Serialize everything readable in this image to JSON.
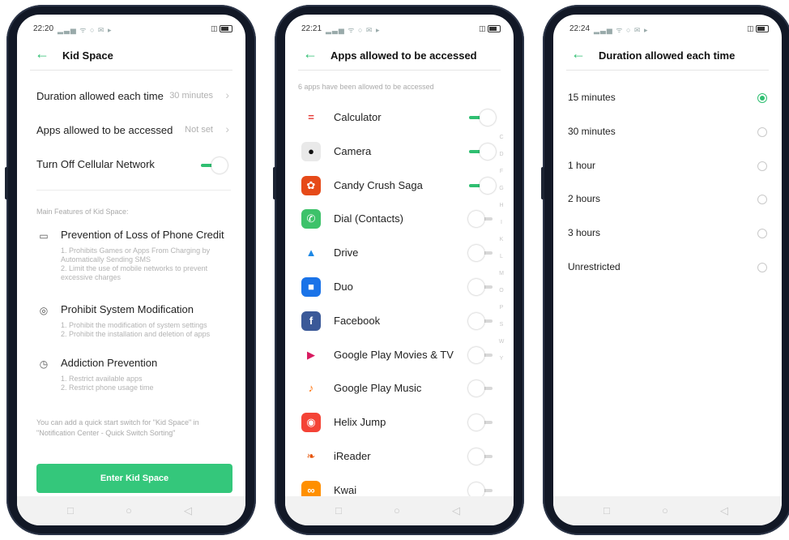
{
  "colors": {
    "accent": "#2fbf71",
    "button": "#34c77b"
  },
  "phones": [
    {
      "status": {
        "time": "22:20"
      },
      "header": {
        "title": "Kid Space"
      },
      "settings": [
        {
          "label": "Duration allowed each time",
          "value": "30 minutes"
        },
        {
          "label": "Apps allowed to be accessed",
          "value": "Not set"
        },
        {
          "label": "Turn Off Cellular Network",
          "toggle": true
        }
      ],
      "features_heading": "Main Features of Kid Space:",
      "features": [
        {
          "title": "Prevention of Loss of Phone Credit",
          "desc": "1. Prohibits Games or Apps From Charging by Automatically Sending SMS\n2. Limit the use of mobile networks to prevent excessive charges"
        },
        {
          "title": "Prohibit System Modification",
          "desc": "1. Prohibit the modification of system settings\n2. Prohibit the installation and deletion of apps"
        },
        {
          "title": "Addiction Prevention",
          "desc": "1. Restrict available apps\n2. Restrict phone usage time"
        }
      ],
      "note": "You can add a quick start switch for \"Kid Space\" in \"Notification Center - Quick Switch Sorting\"",
      "enter_button": "Enter Kid Space"
    },
    {
      "status": {
        "time": "22:21"
      },
      "header": {
        "title": "Apps allowed to be accessed"
      },
      "subtitle": "6 apps have been allowed to be accessed",
      "apps": [
        {
          "name": "Calculator",
          "on": true,
          "icon": "calculator-icon",
          "color": "#ffffff",
          "fg": "#e53935",
          "glyph": "="
        },
        {
          "name": "Camera",
          "on": true,
          "icon": "camera-icon",
          "color": "#e9e9e9",
          "fg": "#111111",
          "glyph": "●"
        },
        {
          "name": "Candy Crush Saga",
          "on": true,
          "icon": "candy-crush-icon",
          "color": "#e64a19",
          "fg": "#ffffff",
          "glyph": "✿"
        },
        {
          "name": "Dial (Contacts)",
          "on": false,
          "icon": "phone-icon",
          "color": "#3dc26a",
          "fg": "#ffffff",
          "glyph": "✆"
        },
        {
          "name": "Drive",
          "on": false,
          "icon": "drive-icon",
          "color": "#ffffff",
          "fg": "#1e88e5",
          "glyph": "▲"
        },
        {
          "name": "Duo",
          "on": false,
          "icon": "duo-icon",
          "color": "#1a73e8",
          "fg": "#ffffff",
          "glyph": "■"
        },
        {
          "name": "Facebook",
          "on": false,
          "icon": "facebook-icon",
          "color": "#3b5998",
          "fg": "#ffffff",
          "glyph": "f"
        },
        {
          "name": "Google Play Movies & TV",
          "on": false,
          "icon": "play-movies-icon",
          "color": "#ffffff",
          "fg": "#d81b60",
          "glyph": "▶"
        },
        {
          "name": "Google Play Music",
          "on": false,
          "icon": "play-music-icon",
          "color": "#ffffff",
          "fg": "#ff6d00",
          "glyph": "♪"
        },
        {
          "name": "Helix Jump",
          "on": false,
          "icon": "helix-jump-icon",
          "color": "#f44336",
          "fg": "#ffffff",
          "glyph": "◉"
        },
        {
          "name": "iReader",
          "on": false,
          "icon": "ireader-icon",
          "color": "#ffffff",
          "fg": "#e65100",
          "glyph": "❧"
        },
        {
          "name": "Kwai",
          "on": false,
          "icon": "kwai-icon",
          "color": "#ff8f00",
          "fg": "#ffffff",
          "glyph": "∞"
        }
      ],
      "alphabet": [
        "C",
        "D",
        "F",
        "G",
        "H",
        "I",
        "K",
        "L",
        "M",
        "O",
        "P",
        "S",
        "W",
        "Y"
      ]
    },
    {
      "status": {
        "time": "22:24"
      },
      "header": {
        "title": "Duration allowed each time"
      },
      "options": [
        {
          "label": "15 minutes",
          "selected": true
        },
        {
          "label": "30 minutes",
          "selected": false
        },
        {
          "label": "1 hour",
          "selected": false
        },
        {
          "label": "2 hours",
          "selected": false
        },
        {
          "label": "3 hours",
          "selected": false
        },
        {
          "label": "Unrestricted",
          "selected": false
        }
      ]
    }
  ]
}
